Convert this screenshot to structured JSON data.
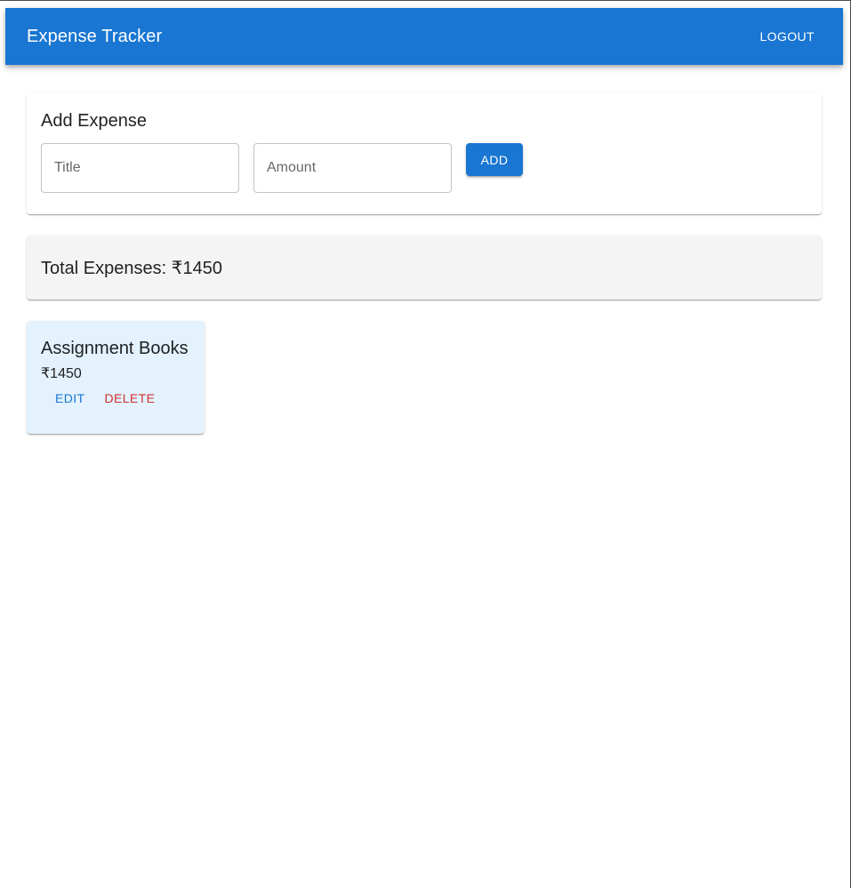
{
  "appbar": {
    "title": "Expense Tracker",
    "logout_label": "LOGOUT",
    "color": "#1976d2"
  },
  "add_expense": {
    "heading": "Add Expense",
    "title_field": {
      "value": "",
      "placeholder": "Title"
    },
    "amount_field": {
      "value": "",
      "placeholder": "Amount"
    },
    "add_label": "ADD"
  },
  "summary": {
    "total_text": "Total Expenses: ₹1450"
  },
  "expenses": [
    {
      "title": "Assignment Books",
      "amount": "₹1450",
      "edit_label": "EDIT",
      "delete_label": "DELETE"
    }
  ],
  "colors": {
    "primary": "#1976d2",
    "danger": "#d32f2f",
    "expense_card_bg": "#e3f2fd",
    "summary_bg": "#f4f4f4"
  }
}
